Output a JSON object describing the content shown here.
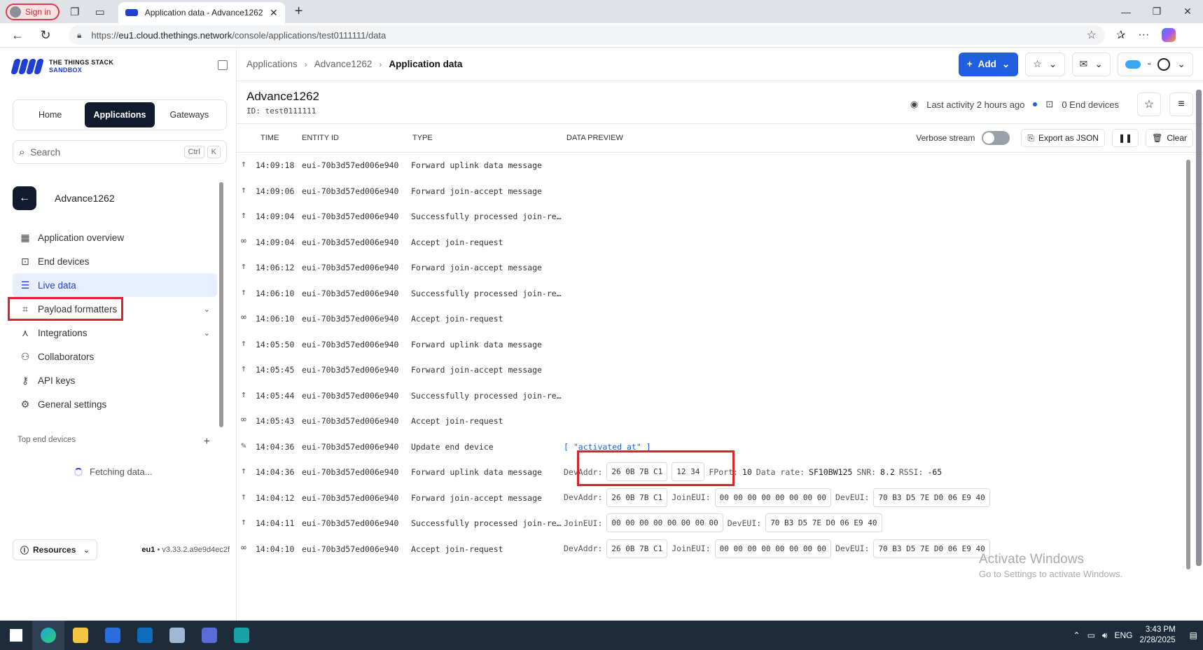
{
  "browser": {
    "signin_label": "Sign in",
    "tab_title": "Application data - Advance1262 -",
    "url_prefix": "https://",
    "url_host": "eu1.cloud.thethings.network",
    "url_path": "/console/applications/test0111111/data"
  },
  "logo": {
    "line1": "THE THINGS STACK",
    "line2": "SANDBOX"
  },
  "switcher": {
    "home": "Home",
    "applications": "Applications",
    "gateways": "Gateways"
  },
  "search": {
    "placeholder": "Search",
    "kbd1": "Ctrl",
    "kbd2": "K"
  },
  "app_context": {
    "name": "Advance1262"
  },
  "nav": {
    "overview": "Application overview",
    "end_devices": "End devices",
    "live_data": "Live data",
    "payload_formatters": "Payload formatters",
    "integrations": "Integrations",
    "collaborators": "Collaborators",
    "api_keys": "API keys",
    "general_settings": "General settings"
  },
  "top_end_devices": {
    "label": "Top end devices",
    "status": "Fetching data..."
  },
  "footer": {
    "resources": "Resources",
    "cluster": "eu1",
    "version": "v3.33.2.a9e9d4ec2f"
  },
  "breadcrumb": {
    "b1": "Applications",
    "b2": "Advance1262",
    "b3": "Application data"
  },
  "topnav": {
    "add_label": "Add"
  },
  "header": {
    "title": "Advance1262",
    "id": "ID: test0111111",
    "last_activity": "Last activity 2 hours ago",
    "end_devices": "0 End devices"
  },
  "table": {
    "col_time": "TIME",
    "col_entity": "ENTITY ID",
    "col_type": "TYPE",
    "col_preview": "DATA PREVIEW",
    "verbose": "Verbose stream",
    "export": "Export as JSON",
    "clear": "Clear"
  },
  "rows": [
    {
      "icon": "↑",
      "time": "14:09:18",
      "eid": "eui-70b3d57ed006e940",
      "type": "Forward uplink data message"
    },
    {
      "icon": "↑",
      "time": "14:09:06",
      "eid": "eui-70b3d57ed006e940",
      "type": "Forward join-accept message"
    },
    {
      "icon": "↑",
      "time": "14:09:04",
      "eid": "eui-70b3d57ed006e940",
      "type": "Successfully processed join-re…"
    },
    {
      "icon": "∞",
      "time": "14:09:04",
      "eid": "eui-70b3d57ed006e940",
      "type": "Accept join-request"
    },
    {
      "icon": "↑",
      "time": "14:06:12",
      "eid": "eui-70b3d57ed006e940",
      "type": "Forward join-accept message"
    },
    {
      "icon": "↑",
      "time": "14:06:10",
      "eid": "eui-70b3d57ed006e940",
      "type": "Successfully processed join-re…"
    },
    {
      "icon": "∞",
      "time": "14:06:10",
      "eid": "eui-70b3d57ed006e940",
      "type": "Accept join-request"
    },
    {
      "icon": "↑",
      "time": "14:05:50",
      "eid": "eui-70b3d57ed006e940",
      "type": "Forward uplink data message"
    },
    {
      "icon": "↑",
      "time": "14:05:45",
      "eid": "eui-70b3d57ed006e940",
      "type": "Forward join-accept message"
    },
    {
      "icon": "↑",
      "time": "14:05:44",
      "eid": "eui-70b3d57ed006e940",
      "type": "Successfully processed join-re…"
    },
    {
      "icon": "∞",
      "time": "14:05:43",
      "eid": "eui-70b3d57ed006e940",
      "type": "Accept join-request"
    },
    {
      "icon": "✎",
      "time": "14:04:36",
      "eid": "eui-70b3d57ed006e940",
      "type": "Update end device",
      "preview": "[ \"activated_at\" ]"
    },
    {
      "icon": "↑",
      "time": "14:04:36",
      "eid": "eui-70b3d57ed006e940",
      "type": "Forward uplink data message"
    },
    {
      "icon": "↑",
      "time": "14:04:12",
      "eid": "eui-70b3d57ed006e940",
      "type": "Forward join-accept message"
    },
    {
      "icon": "↑",
      "time": "14:04:11",
      "eid": "eui-70b3d57ed006e940",
      "type": "Successfully processed join-re…"
    },
    {
      "icon": "∞",
      "time": "14:04:10",
      "eid": "eui-70b3d57ed006e940",
      "type": "Accept join-request"
    }
  ],
  "previews": {
    "r12": {
      "k1": "DevAddr:",
      "v1": "26 0B 7B C1",
      "v2": "12 34",
      "k3": "FPort:",
      "v3": "10",
      "k4": "Data rate:",
      "v4": "SF10BW125",
      "k5": "SNR:",
      "v5": "8.2",
      "k6": "RSSI:",
      "v6": "-65"
    },
    "r13": {
      "k1": "DevAddr:",
      "v1": "26 0B 7B C1",
      "k2": "JoinEUI:",
      "v2": "00 00 00 00 00 00 00 00",
      "k3": "DevEUI:",
      "v3": "70 B3 D5 7E D0 06 E9 40"
    },
    "r14": {
      "k1": "JoinEUI:",
      "v1": "00 00 00 00 00 00 00 00",
      "k2": "DevEUI:",
      "v2": "70 B3 D5 7E D0 06 E9 40"
    },
    "r15": {
      "k1": "DevAddr:",
      "v1": "26 0B 7B C1",
      "k2": "JoinEUI:",
      "v2": "00 00 00 00 00 00 00 00",
      "k3": "DevEUI:",
      "v3": "70 B3 D5 7E D0 06 E9 40"
    }
  },
  "watermark": {
    "line1": "Activate Windows",
    "line2": "Go to Settings to activate Windows."
  },
  "taskbar": {
    "time": "3:43 PM",
    "date": "2/28/2025",
    "lang": "ENG"
  }
}
